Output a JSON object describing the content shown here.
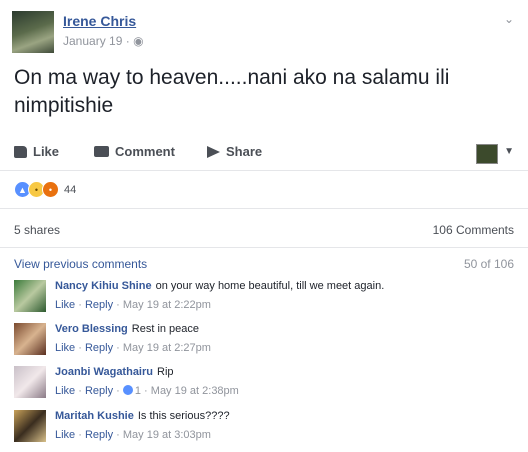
{
  "post": {
    "author": "Irene Chris",
    "date": "January 19",
    "body": "On ma way to heaven.....nani ako na salamu ili nimpitishie",
    "actions": {
      "like": "Like",
      "comment": "Comment",
      "share": "Share"
    },
    "reaction_count": "44",
    "shares": "5 shares",
    "comments_total": "106 Comments",
    "view_previous": "View previous comments",
    "pager": "50 of 106"
  },
  "comments": [
    {
      "name": "Nancy Kihiu Shine",
      "text": "on your way home beautiful, till we meet again.",
      "like": "Like",
      "reply": "Reply",
      "likes": "",
      "time": "May 19 at 2:22pm"
    },
    {
      "name": "Vero Blessing",
      "text": "Rest in peace",
      "like": "Like",
      "reply": "Reply",
      "likes": "",
      "time": "May 19 at 2:27pm"
    },
    {
      "name": "Joanbi Wagathairu",
      "text": "Rip",
      "like": "Like",
      "reply": "Reply",
      "likes": "1",
      "time": "May 19 at 2:38pm"
    },
    {
      "name": "Maritah Kushie",
      "text": "Is this serious????",
      "like": "Like",
      "reply": "Reply",
      "likes": "",
      "time": "May 19 at 3:03pm"
    }
  ],
  "colors": {
    "link": "#365899",
    "text": "#1d2129",
    "muted": "#90949c",
    "like": "#5890ff"
  },
  "icons": [
    "globe-icon",
    "chevron-down-icon",
    "like-icon",
    "comment-icon",
    "share-icon",
    "like-reaction-icon",
    "sad-reaction-icon",
    "angry-reaction-icon"
  ]
}
